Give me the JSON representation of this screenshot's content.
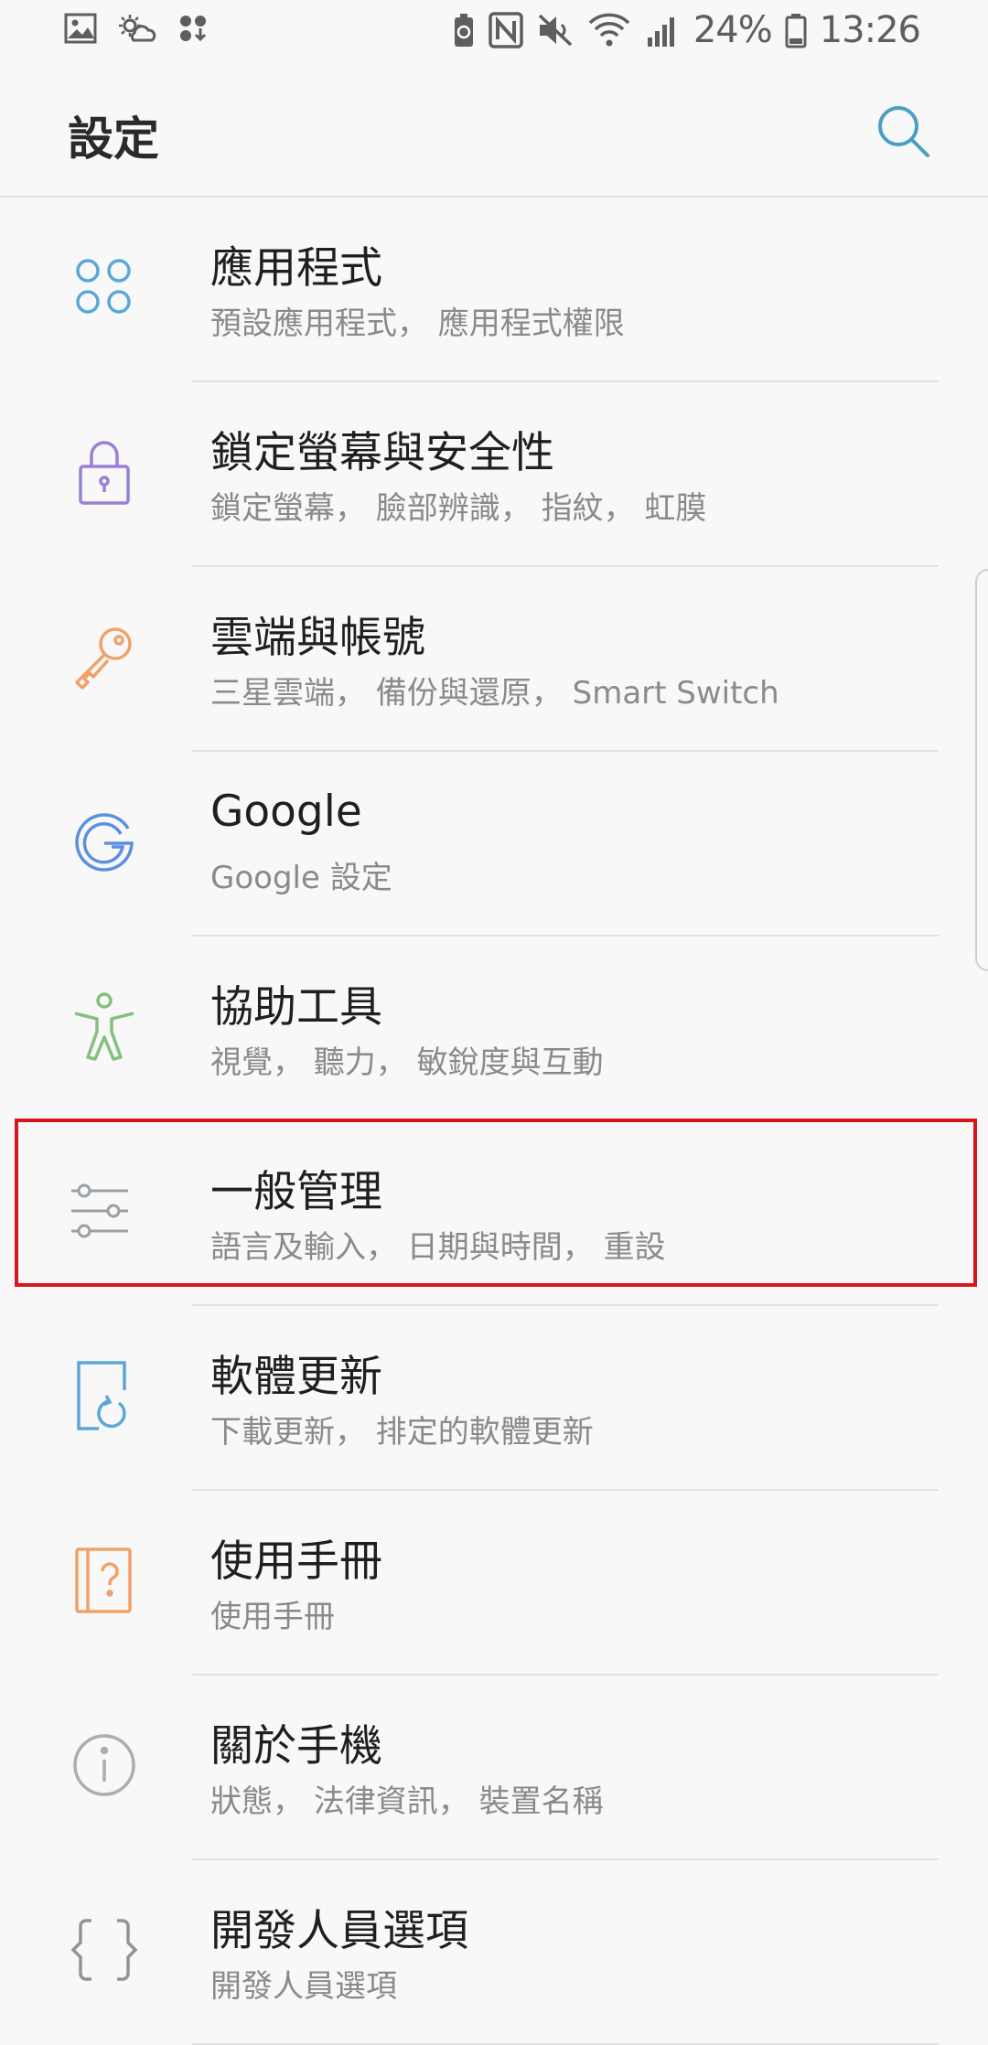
{
  "status_bar": {
    "battery_percent": "24%",
    "time": "13:26",
    "icons_left": [
      "gallery-icon",
      "weather-icon",
      "app-download-icon"
    ],
    "icons_right": [
      "battery-saver-icon",
      "nfc-icon",
      "mute-icon",
      "wifi-icon",
      "signal-icon",
      "battery-icon"
    ]
  },
  "header": {
    "title": "設定",
    "search_icon": "search-icon"
  },
  "settings": [
    {
      "id": "apps",
      "title": "應用程式",
      "subtitle": "預設應用程式， 應用程式權限",
      "icon": "apps-icon",
      "color": "#5aa7d8"
    },
    {
      "id": "lockscreen",
      "title": "鎖定螢幕與安全性",
      "subtitle": "鎖定螢幕， 臉部辨識， 指紋， 虹膜",
      "icon": "lock-icon",
      "color": "#9a80d6"
    },
    {
      "id": "cloud",
      "title": "雲端與帳號",
      "subtitle": "三星雲端， 備份與還原， Smart Switch",
      "icon": "key-icon",
      "color": "#f0a26a"
    },
    {
      "id": "google",
      "title": "Google",
      "subtitle": "Google 設定",
      "icon": "google-icon",
      "color": "#5b8fe0"
    },
    {
      "id": "accessibility",
      "title": "協助工具",
      "subtitle": "視覺， 聽力， 敏銳度與互動",
      "icon": "accessibility-icon",
      "color": "#85c17e"
    },
    {
      "id": "general",
      "title": "一般管理",
      "subtitle": "語言及輸入， 日期與時間， 重設",
      "icon": "sliders-icon",
      "color": "#9aa0a6"
    },
    {
      "id": "update",
      "title": "軟體更新",
      "subtitle": "下載更新， 排定的軟體更新",
      "icon": "software-update-icon",
      "color": "#5aa7d8"
    },
    {
      "id": "manual",
      "title": "使用手冊",
      "subtitle": "使用手冊",
      "icon": "user-manual-icon",
      "color": "#f0a26a"
    },
    {
      "id": "about",
      "title": "關於手機",
      "subtitle": "狀態， 法律資訊， 裝置名稱",
      "icon": "info-icon",
      "color": "#a8aeb3"
    },
    {
      "id": "developer",
      "title": "開發人員選項",
      "subtitle": "開發人員選項",
      "icon": "developer-braces-icon",
      "color": "#8f9498"
    }
  ],
  "highlight_color": "#d7161e"
}
